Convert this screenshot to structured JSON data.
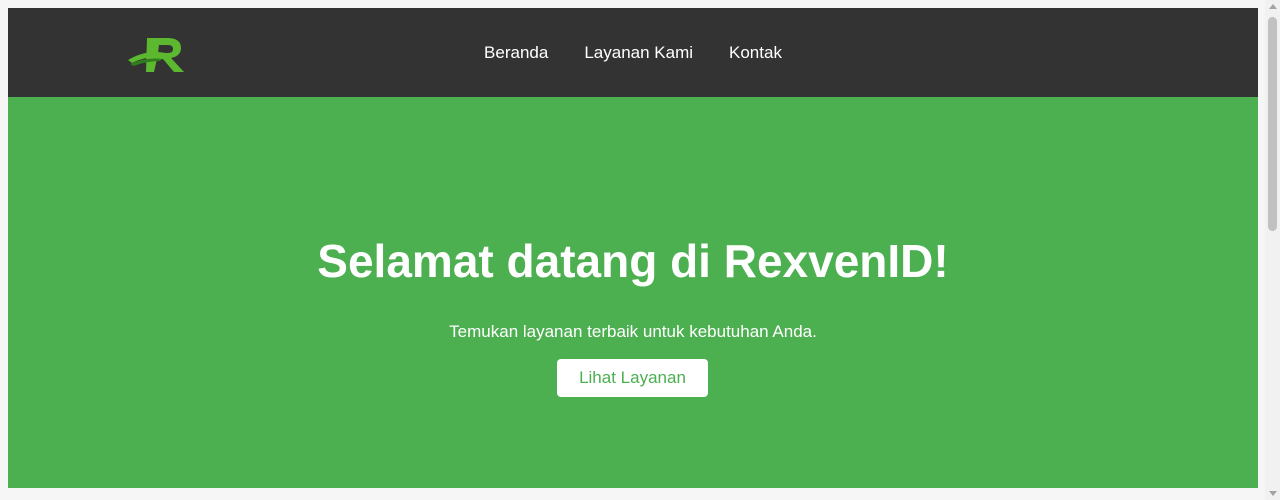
{
  "colors": {
    "navbar_bg": "#333333",
    "hero_bg": "#4caf50",
    "brand_green": "#4caf50",
    "logo_green": "#5cb82f",
    "logo_dark_green": "#2f7d1c",
    "text_light": "#ffffff"
  },
  "navbar": {
    "logo_icon": "rexven-r-logo-icon",
    "links": [
      {
        "label": "Beranda"
      },
      {
        "label": "Layanan Kami"
      },
      {
        "label": "Kontak"
      }
    ]
  },
  "hero": {
    "title": "Selamat datang di RexvenID!",
    "subtitle": "Temukan layanan terbaik untuk kebutuhan Anda.",
    "button_label": "Lihat Layanan"
  }
}
